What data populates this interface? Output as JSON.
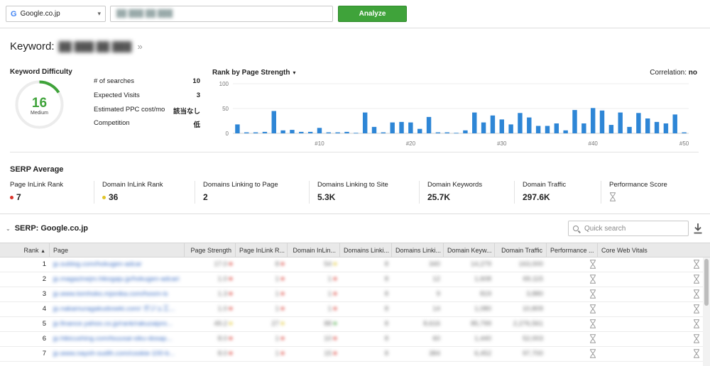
{
  "toolbar": {
    "engine": "Google.co.jp",
    "keyword_value": "██ ███ ██ ███",
    "analyze_label": "Analyze"
  },
  "keyword": {
    "label": "Keyword:",
    "value": "██ ███ ██ ███"
  },
  "difficulty": {
    "title": "Keyword Difficulty",
    "value": "16",
    "level": "Medium",
    "score_fraction": 0.16,
    "color": "#3fa33a"
  },
  "stats": [
    {
      "label": "# of searches",
      "value": "10"
    },
    {
      "label": "Expected Visits",
      "value": "3"
    },
    {
      "label": "Estimated PPC cost/mo",
      "value": "該当なし"
    },
    {
      "label": "Competition",
      "value": "低"
    }
  ],
  "rank_chart": {
    "title": "Rank by Page Strength",
    "correlation_label": "Correlation:",
    "correlation_value": "no"
  },
  "chart_data": {
    "type": "bar",
    "x": [
      1,
      2,
      3,
      4,
      5,
      6,
      7,
      8,
      9,
      10,
      11,
      12,
      13,
      14,
      15,
      16,
      17,
      18,
      19,
      20,
      21,
      22,
      23,
      24,
      25,
      26,
      27,
      28,
      29,
      30,
      31,
      32,
      33,
      34,
      35,
      36,
      37,
      38,
      39,
      40,
      41,
      42,
      43,
      44,
      45,
      46,
      47,
      48,
      49,
      50
    ],
    "values": [
      18,
      2,
      2,
      3,
      45,
      6,
      7,
      3,
      3,
      11,
      2,
      2,
      3,
      1,
      42,
      13,
      2,
      22,
      23,
      22,
      9,
      33,
      2,
      2,
      1,
      6,
      42,
      22,
      36,
      28,
      18,
      41,
      32,
      15,
      15,
      20,
      6,
      47,
      20,
      51,
      46,
      17,
      42,
      13,
      41,
      30,
      23,
      20,
      38,
      2
    ],
    "tick_labels": [
      "#10",
      "#20",
      "#30",
      "#40",
      "#50"
    ],
    "tick_positions": [
      10,
      20,
      30,
      40,
      50
    ],
    "yticks": [
      0,
      50,
      100
    ],
    "ylim": [
      0,
      100
    ],
    "color": "#2e86d6"
  },
  "serp_average": {
    "title": "SERP Average",
    "metrics": [
      {
        "label": "Page InLink Rank",
        "value": "7",
        "dot": "#d9342b"
      },
      {
        "label": "Domain InLink Rank",
        "value": "36",
        "dot": "#e0c427"
      },
      {
        "label": "Domains Linking to Page",
        "value": "2"
      },
      {
        "label": "Domains Linking to Site",
        "value": "5.3K"
      },
      {
        "label": "Domain Keywords",
        "value": "25.7K"
      },
      {
        "label": "Domain Traffic",
        "value": "297.6K"
      },
      {
        "label": "Performance Score",
        "value": "",
        "icon": "hourglass-icon"
      }
    ]
  },
  "serp": {
    "title": "SERP: Google.co.jp",
    "search_placeholder": "Quick search",
    "columns": [
      "Rank",
      "Page",
      "Page Strength",
      "Page InLink R...",
      "Domain InLin...",
      "Domains Linki...",
      "Domains Linki...",
      "Domain Keyw...",
      "Domain Traffic",
      "Performance ...",
      "Core Web Vitals"
    ],
    "rows": [
      {
        "rank": "1",
        "page": "jp.sublog.com/hokugen-adcar",
        "ps": "17.0",
        "pir": "8",
        "dir": "54",
        "dlp": "8",
        "dls": "340",
        "dk": "14,279",
        "dt": "163,000",
        "dots": [
          "#d9342b",
          "#d9342b",
          "#e0c427"
        ]
      },
      {
        "rank": "2",
        "page": "jp.magazinejm.hikogaju.jp/hokugen-adcari",
        "ps": "1.0",
        "pir": "1",
        "dir": "1",
        "dlp": "8",
        "dls": "12",
        "dk": "1,608",
        "dt": "69,115",
        "dots": [
          "#d9342b",
          "#d9342b",
          "#d9342b"
        ]
      },
      {
        "rank": "3",
        "page": "jp.www.tomhoko.mjonika.com/hoom-is",
        "ps": "1.3",
        "pir": "1",
        "dir": "1",
        "dlp": "8",
        "dls": "9",
        "dk": "819",
        "dt": "3,880",
        "dots": [
          "#d9342b",
          "#d9342b",
          "#d9342b"
        ]
      },
      {
        "rank": "4",
        "page": "jp.nakamuragakudoseki.com/ ガジュ工...",
        "ps": "1.0",
        "pir": "1",
        "dir": "1",
        "dlp": "8",
        "dls": "14",
        "dk": "1,080",
        "dt": "10,809",
        "dots": [
          "#d9342b",
          "#d9342b",
          "#d9342b"
        ]
      },
      {
        "rank": "5",
        "page": "jp.finance.yahoo.co.jp/rank/rakuzaipro...",
        "ps": "49.2",
        "pir": "27",
        "dir": "88",
        "dlp": "8",
        "dls": "8,616",
        "dk": "85,799",
        "dt": "2,276,561",
        "dots": [
          "#e0c427",
          "#e0c427",
          "#3fa33a"
        ]
      },
      {
        "rank": "6",
        "page": "jp.hikicushing.com/tsuusai-siku-dosap...",
        "ps": "8.0",
        "pir": "1",
        "dir": "10",
        "dlp": "8",
        "dls": "60",
        "dk": "1,440",
        "dt": "52,003",
        "dots": [
          "#d9342b",
          "#d9342b",
          "#d9342b"
        ]
      },
      {
        "rank": "7",
        "page": "jp.www.nayoh-sudth.com/cookie-100-b...",
        "ps": "8.0",
        "pir": "1",
        "dir": "15",
        "dlp": "8",
        "dls": "384",
        "dk": "6,452",
        "dt": "97,700",
        "dots": [
          "#d9342b",
          "#d9342b",
          "#d9342b"
        ]
      }
    ]
  }
}
